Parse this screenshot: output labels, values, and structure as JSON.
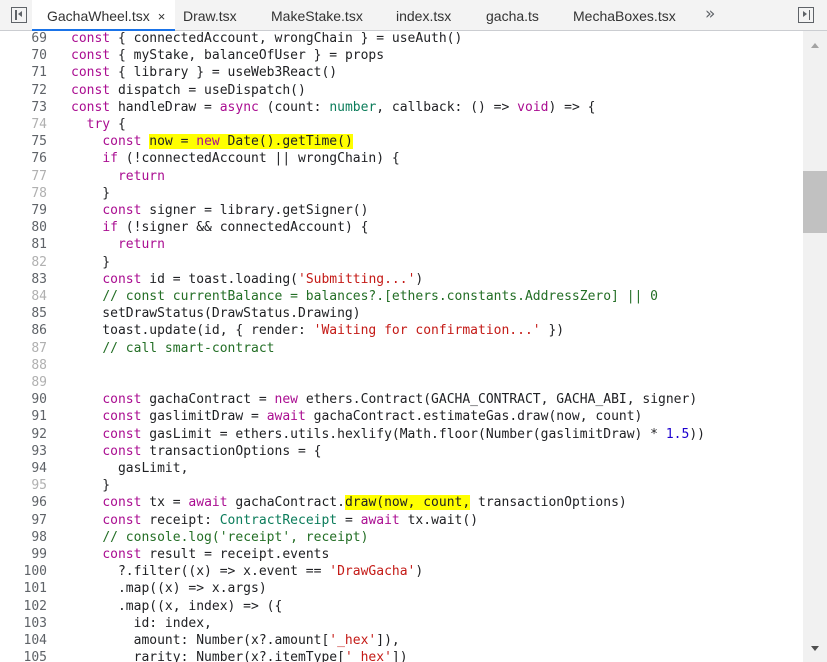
{
  "tabs": [
    {
      "label": "GachaWheel.tsx",
      "active": true,
      "close": "×"
    },
    {
      "label": "Draw.tsx"
    },
    {
      "label": "MakeStake.tsx"
    },
    {
      "label": "index.tsx"
    },
    {
      "label": "gacha.ts"
    },
    {
      "label": "MechaBoxes.tsx"
    }
  ],
  "more_tabs": "»",
  "colors": {
    "highlight": "#ffff00",
    "keyword": "#aa0d91",
    "string": "#c41a16",
    "comment": "#236e25",
    "type": "#0b7c5a",
    "number": "#1c00cf"
  },
  "code": {
    "lines": [
      {
        "n": "69",
        "segs": [
          {
            "t": "const",
            "c": "k"
          },
          {
            "t": " { connectedAccount, wrongChain } = useAuth()"
          }
        ]
      },
      {
        "n": "70",
        "segs": [
          {
            "t": "const",
            "c": "k"
          },
          {
            "t": " { myStake, balanceOfUser } = props"
          }
        ]
      },
      {
        "n": "71",
        "segs": [
          {
            "t": "const",
            "c": "k"
          },
          {
            "t": " { library } = useWeb3React()"
          }
        ]
      },
      {
        "n": "72",
        "segs": [
          {
            "t": "const",
            "c": "k"
          },
          {
            "t": " dispatch = useDispatch()"
          }
        ]
      },
      {
        "n": "73",
        "segs": [
          {
            "t": "const",
            "c": "k"
          },
          {
            "t": " handleDraw = "
          },
          {
            "t": "async",
            "c": "k"
          },
          {
            "t": " (count: "
          },
          {
            "t": "number",
            "c": "t"
          },
          {
            "t": ", callback: () => "
          },
          {
            "t": "void",
            "c": "k"
          },
          {
            "t": ") => {"
          }
        ]
      },
      {
        "n": "74",
        "dim": true,
        "segs": [
          {
            "t": "  "
          },
          {
            "t": "try",
            "c": "k"
          },
          {
            "t": " {"
          }
        ]
      },
      {
        "n": "75",
        "segs": [
          {
            "t": "    "
          },
          {
            "t": "const",
            "c": "k"
          },
          {
            "t": " "
          },
          {
            "t": "now = ",
            "h": 1
          },
          {
            "t": "new",
            "c": "k",
            "h": 1
          },
          {
            "t": " Date().getTime()",
            "h": 1
          }
        ]
      },
      {
        "n": "76",
        "segs": [
          {
            "t": "    "
          },
          {
            "t": "if",
            "c": "k"
          },
          {
            "t": " (!connectedAccount || wrongChain) {"
          }
        ]
      },
      {
        "n": "77",
        "dim": true,
        "segs": [
          {
            "t": "      "
          },
          {
            "t": "return",
            "c": "k"
          }
        ]
      },
      {
        "n": "78",
        "dim": true,
        "segs": [
          {
            "t": "    }"
          }
        ]
      },
      {
        "n": "79",
        "segs": [
          {
            "t": "    "
          },
          {
            "t": "const",
            "c": "k"
          },
          {
            "t": " signer = library.getSigner()"
          }
        ]
      },
      {
        "n": "80",
        "segs": [
          {
            "t": "    "
          },
          {
            "t": "if",
            "c": "k"
          },
          {
            "t": " (!signer && connectedAccount) {"
          }
        ]
      },
      {
        "n": "81",
        "segs": [
          {
            "t": "      "
          },
          {
            "t": "return",
            "c": "k"
          }
        ]
      },
      {
        "n": "82",
        "dim": true,
        "segs": [
          {
            "t": "    }"
          }
        ]
      },
      {
        "n": "83",
        "segs": [
          {
            "t": "    "
          },
          {
            "t": "const",
            "c": "k"
          },
          {
            "t": " id = toast.loading("
          },
          {
            "t": "'Submitting...'",
            "c": "s"
          },
          {
            "t": ")"
          }
        ]
      },
      {
        "n": "84",
        "dim": true,
        "segs": [
          {
            "t": "    "
          },
          {
            "t": "// const currentBalance = balances?.[ethers.constants.AddressZero] || 0",
            "c": "c"
          }
        ]
      },
      {
        "n": "85",
        "segs": [
          {
            "t": "    setDrawStatus(DrawStatus.Drawing)"
          }
        ]
      },
      {
        "n": "86",
        "segs": [
          {
            "t": "    toast.update(id, { render: "
          },
          {
            "t": "'Waiting for confirmation...'",
            "c": "s"
          },
          {
            "t": " })"
          }
        ]
      },
      {
        "n": "87",
        "dim": true,
        "segs": [
          {
            "t": "    "
          },
          {
            "t": "// call smart-contract",
            "c": "c"
          }
        ]
      },
      {
        "n": "88",
        "dim": true,
        "segs": []
      },
      {
        "n": "89",
        "dim": true,
        "segs": []
      },
      {
        "n": "90",
        "segs": [
          {
            "t": "    "
          },
          {
            "t": "const",
            "c": "k"
          },
          {
            "t": " gachaContract = "
          },
          {
            "t": "new",
            "c": "k"
          },
          {
            "t": " ethers.Contract(GACHA_CONTRACT, GACHA_ABI, signer)"
          }
        ]
      },
      {
        "n": "91",
        "segs": [
          {
            "t": "    "
          },
          {
            "t": "const",
            "c": "k"
          },
          {
            "t": " gaslimitDraw = "
          },
          {
            "t": "await",
            "c": "k"
          },
          {
            "t": " gachaContract.estimateGas.draw(now, count)"
          }
        ]
      },
      {
        "n": "92",
        "segs": [
          {
            "t": "    "
          },
          {
            "t": "const",
            "c": "k"
          },
          {
            "t": " gasLimit = ethers.utils.hexlify(Math.floor(Number(gaslimitDraw) * "
          },
          {
            "t": "1.5",
            "c": "n"
          },
          {
            "t": "))"
          }
        ]
      },
      {
        "n": "93",
        "segs": [
          {
            "t": "    "
          },
          {
            "t": "const",
            "c": "k"
          },
          {
            "t": " transactionOptions = {"
          }
        ]
      },
      {
        "n": "94",
        "segs": [
          {
            "t": "      gasLimit,"
          }
        ]
      },
      {
        "n": "95",
        "dim": true,
        "segs": [
          {
            "t": "    }"
          }
        ]
      },
      {
        "n": "96",
        "segs": [
          {
            "t": "    "
          },
          {
            "t": "const",
            "c": "k"
          },
          {
            "t": " tx = "
          },
          {
            "t": "await",
            "c": "k"
          },
          {
            "t": " gachaContract."
          },
          {
            "t": "draw(now, count,",
            "h": 1
          },
          {
            "t": " transactionOptions)"
          }
        ]
      },
      {
        "n": "97",
        "segs": [
          {
            "t": "    "
          },
          {
            "t": "const",
            "c": "k"
          },
          {
            "t": " receipt: "
          },
          {
            "t": "ContractReceipt",
            "c": "t"
          },
          {
            "t": " = "
          },
          {
            "t": "await",
            "c": "k"
          },
          {
            "t": " tx.wait()"
          }
        ]
      },
      {
        "n": "98",
        "segs": [
          {
            "t": "    "
          },
          {
            "t": "// console.log('receipt', receipt)",
            "c": "c"
          }
        ]
      },
      {
        "n": "99",
        "segs": [
          {
            "t": "    "
          },
          {
            "t": "const",
            "c": "k"
          },
          {
            "t": " result = receipt.events"
          }
        ]
      },
      {
        "n": "100",
        "segs": [
          {
            "t": "      ?.filter((x) => x.event == "
          },
          {
            "t": "'DrawGacha'",
            "c": "s"
          },
          {
            "t": ")"
          }
        ]
      },
      {
        "n": "101",
        "segs": [
          {
            "t": "      .map((x) => x.args)"
          }
        ]
      },
      {
        "n": "102",
        "segs": [
          {
            "t": "      .map((x, index) => ({"
          }
        ]
      },
      {
        "n": "103",
        "segs": [
          {
            "t": "        id: index,"
          }
        ]
      },
      {
        "n": "104",
        "segs": [
          {
            "t": "        amount: Number(x?.amount["
          },
          {
            "t": "'_hex'",
            "c": "s"
          },
          {
            "t": "]),"
          }
        ]
      },
      {
        "n": "105",
        "segs": [
          {
            "t": "        rarity: Number(x?.itemType["
          },
          {
            "t": "'_hex'",
            "c": "s"
          },
          {
            "t": "])"
          }
        ]
      }
    ]
  }
}
